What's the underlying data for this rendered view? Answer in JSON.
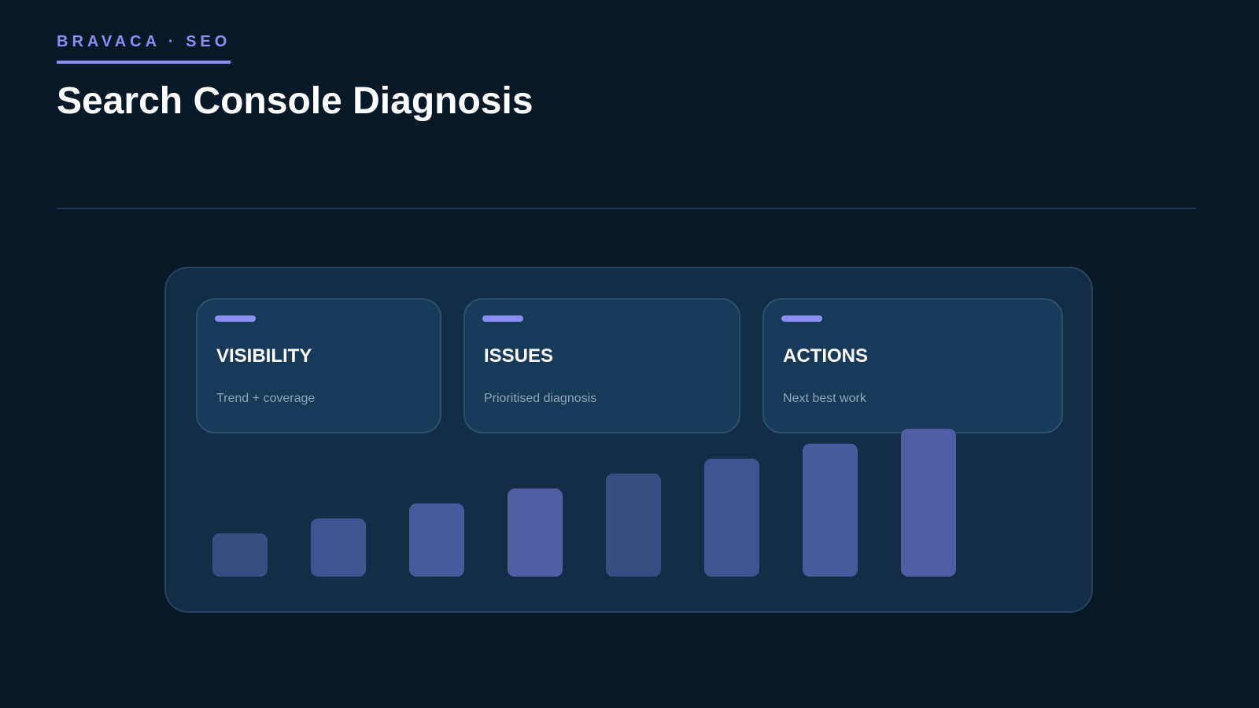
{
  "header": {
    "eyebrow": "BRAVACA · SEO",
    "title": "Search Console Diagnosis"
  },
  "cards": [
    {
      "title": "VISIBILITY",
      "subtitle": "Trend + coverage"
    },
    {
      "title": "ISSUES",
      "subtitle": "Prioritised diagnosis"
    },
    {
      "title": "ACTIONS",
      "subtitle": "Next best work"
    }
  ],
  "bars": {
    "levels": [
      1,
      2,
      3,
      4,
      5,
      6,
      7,
      8
    ],
    "max_level": 8,
    "colors": [
      "#364e82",
      "#3f5390",
      "#475a9c",
      "#4e5fa4",
      "#364e82",
      "#3f5390",
      "#475a9c",
      "#4e5fa4"
    ]
  },
  "colors": {
    "background": "#071827",
    "accent": "#8b8ff5",
    "panel": "#122d45",
    "card": "#173a58"
  }
}
